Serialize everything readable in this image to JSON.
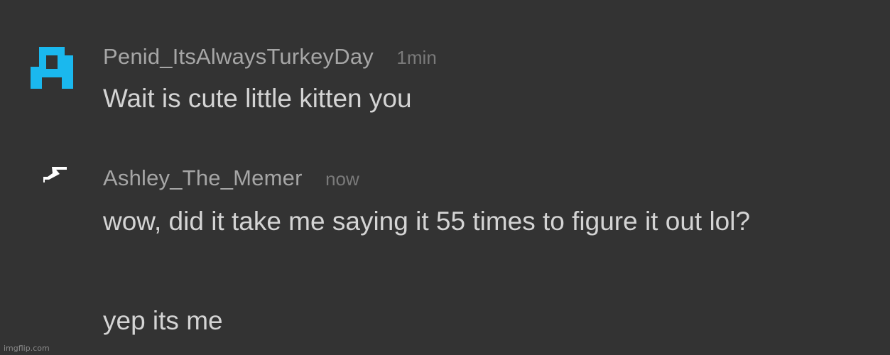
{
  "comments": [
    {
      "username": "Penid_ItsAlwaysTurkeyDay",
      "time": "1min",
      "avatar_icon": "pixel-block-avatar-icon",
      "avatar_color": "#1ab8ee",
      "text": "Wait is cute little kitten you"
    },
    {
      "username": "Ashley_The_Memer",
      "time": "now",
      "avatar_icon": "lightning-bolt-avatar-icon",
      "avatar_color": "#ffffff",
      "text": "wow, did it take me saying it 55 times to figure it out lol?",
      "text2": "yep its me"
    }
  ],
  "watermark": "imgflip.com"
}
